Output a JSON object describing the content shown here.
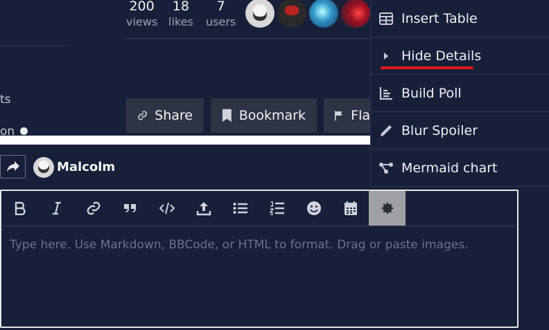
{
  "stats": [
    {
      "num": "200",
      "label": "views"
    },
    {
      "num": "18",
      "label": "likes"
    },
    {
      "num": "7",
      "label": "users"
    }
  ],
  "sidebar": {
    "text1": "ts",
    "text2": "on"
  },
  "actions": {
    "share": "Share",
    "bookmark": "Bookmark",
    "flag": "Fla"
  },
  "composer": {
    "username": "Malcolm",
    "placeholder": "Type here. Use Markdown, BBCode, or HTML to format. Drag or paste images."
  },
  "menu": {
    "items": [
      {
        "label": "Insert Table",
        "icon": "table-icon"
      },
      {
        "label": "Hide Details",
        "icon": "caret-right-icon"
      },
      {
        "label": "Build Poll",
        "icon": "chart-bar-icon"
      },
      {
        "label": "Blur Spoiler",
        "icon": "pen-icon"
      },
      {
        "label": "Mermaid chart",
        "icon": "diagram-icon"
      }
    ]
  },
  "colors": {
    "background": "#182039",
    "button": "#2f3444",
    "highlight_underline": "#e01a1a"
  }
}
